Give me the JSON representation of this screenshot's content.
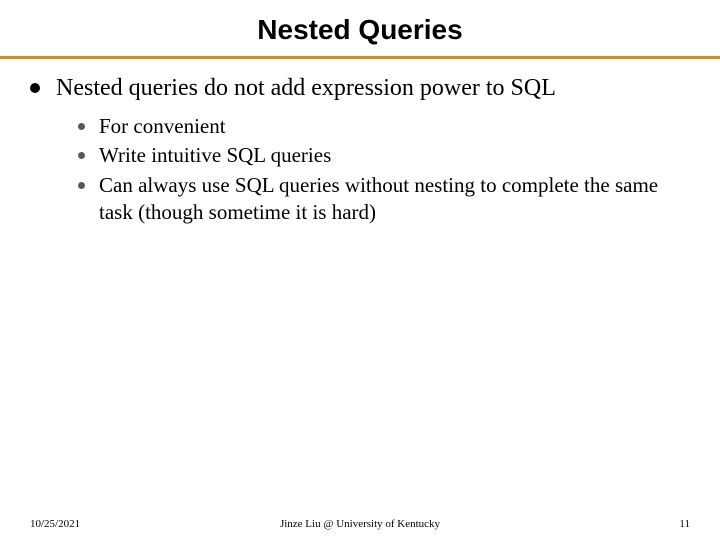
{
  "title": "Nested Queries",
  "main_point": "Nested queries do not add expression power to SQL",
  "sub_points": [
    "For convenient",
    "Write intuitive SQL queries",
    "Can always use SQL queries without nesting to complete the same task (though sometime it is hard)"
  ],
  "footer": {
    "date": "10/25/2021",
    "attribution": "Jinze Liu @ University of Kentucky",
    "page": "11"
  }
}
